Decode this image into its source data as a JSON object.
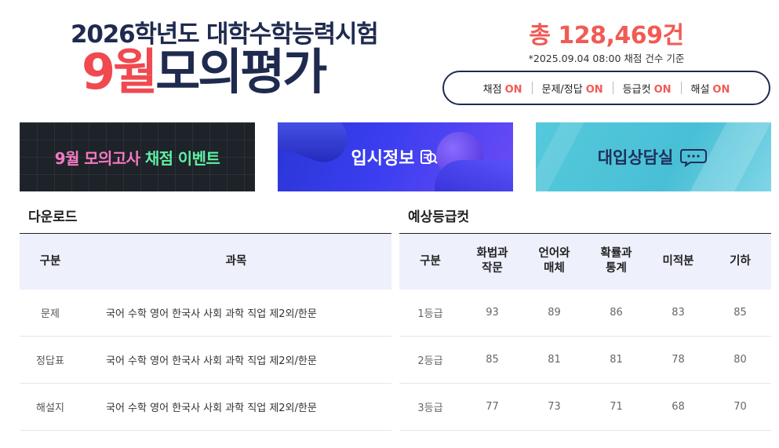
{
  "header": {
    "subtitle": "2026학년도 대학수학능력시험",
    "title_accent": "9월",
    "title_rest": "모의평가",
    "total_count": "총 128,469건",
    "count_basis": "*2025.09.04 08:00 채점 건수 기준",
    "status_items": [
      {
        "label": "채점",
        "state": "ON"
      },
      {
        "label": "문제/정답",
        "state": "ON"
      },
      {
        "label": "등급컷",
        "state": "ON"
      },
      {
        "label": "해설",
        "state": "ON"
      }
    ]
  },
  "banners": {
    "event": {
      "part1": "9월 모의고사",
      "part2": "채점 이벤트"
    },
    "admission": {
      "label": "입시정보"
    },
    "consult": {
      "label": "대입상담실"
    }
  },
  "download": {
    "section_title": "다운로드",
    "columns": [
      "구분",
      "과목"
    ],
    "rows": [
      {
        "category": "문제",
        "subjects": "국어 수학 영어 한국사 사회 과학 직업 제2외/한문"
      },
      {
        "category": "정답표",
        "subjects": "국어 수학 영어 한국사 사회 과학 직업 제2외/한문"
      },
      {
        "category": "해설지",
        "subjects": "국어 수학 영어 한국사 사회 과학 직업 제2외/한문"
      }
    ]
  },
  "grade_cut": {
    "section_title": "예상등급컷",
    "columns": [
      "구분",
      "화법과\n작문",
      "언어와\n매체",
      "확률과\n통계",
      "미적분",
      "기하"
    ],
    "rows": [
      {
        "grade": "1등급",
        "values": [
          "93",
          "89",
          "86",
          "83",
          "85"
        ]
      },
      {
        "grade": "2등급",
        "values": [
          "85",
          "81",
          "81",
          "78",
          "80"
        ]
      },
      {
        "grade": "3등급",
        "values": [
          "77",
          "73",
          "71",
          "68",
          "70"
        ]
      }
    ]
  },
  "colors": {
    "accent": "#f0494f",
    "navy": "#1f2a4f",
    "header_bg": "#eef0fc"
  }
}
